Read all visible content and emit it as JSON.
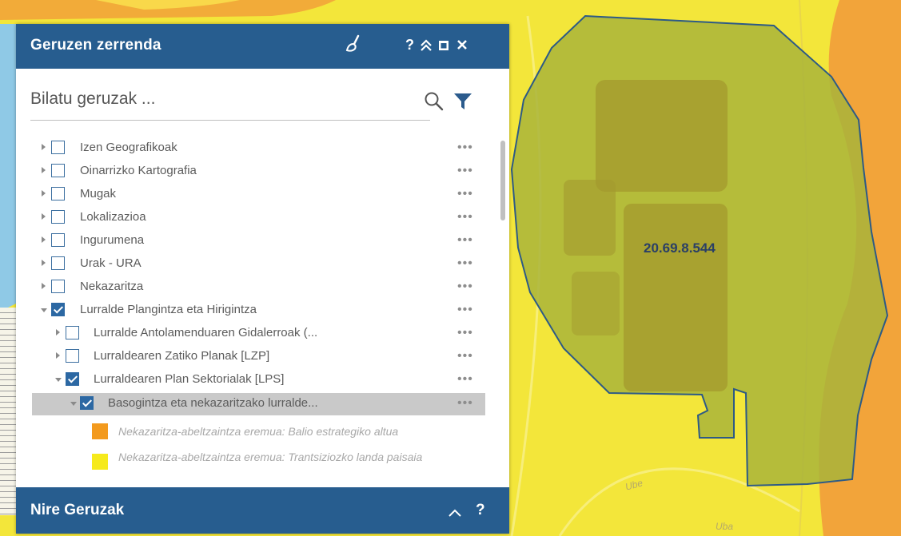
{
  "panel": {
    "title": "Geruzen zerrenda",
    "help": "?",
    "search_placeholder": "Bilatu geruzak ..."
  },
  "layers": [
    {
      "label": "Izen Geografikoak",
      "checked": false,
      "expanded": false,
      "level": 0
    },
    {
      "label": "Oinarrizko Kartografia",
      "checked": false,
      "expanded": false,
      "level": 0
    },
    {
      "label": "Mugak",
      "checked": false,
      "expanded": false,
      "level": 0
    },
    {
      "label": "Lokalizazioa",
      "checked": false,
      "expanded": false,
      "level": 0
    },
    {
      "label": "Ingurumena",
      "checked": false,
      "expanded": false,
      "level": 0
    },
    {
      "label": "Urak - URA",
      "checked": false,
      "expanded": false,
      "level": 0
    },
    {
      "label": "Nekazaritza",
      "checked": false,
      "expanded": false,
      "level": 0
    },
    {
      "label": "Lurralde Plangintza eta Hirigintza",
      "checked": true,
      "expanded": true,
      "level": 0
    },
    {
      "label": "Lurralde Antolamenduaren Gidalerroak (...",
      "checked": false,
      "expanded": false,
      "level": 1
    },
    {
      "label": "Lurraldearen Zatiko Planak [LZP]",
      "checked": false,
      "expanded": false,
      "level": 1
    },
    {
      "label": "Lurraldearen Plan Sektorialak [LPS]",
      "checked": true,
      "expanded": true,
      "level": 1
    },
    {
      "label": "Basogintza eta nekazaritzako lurralde...",
      "checked": true,
      "expanded": true,
      "level": 2,
      "selected": true
    }
  ],
  "more_icon": "•••",
  "legend": [
    {
      "label": "Nekazaritza-abeltzaintza eremua: Balio estrategiko altua",
      "color": "#f39a1e"
    },
    {
      "label": "Nekazaritza-abeltzaintza eremua: Trantsiziozko landa paisaia",
      "color": "#f6ea1c"
    }
  ],
  "footer": {
    "title": "Nire Geruzak",
    "chevron": "^",
    "help": "?"
  },
  "map": {
    "parcel_label": "20.69.8.544",
    "road_labels": [
      "Ube",
      "Uba"
    ]
  },
  "colors": {
    "header": "#275d8f",
    "checkbox": "#2c68a3",
    "map_yellow": "#f3e63a",
    "map_orange": "#f2a43a",
    "parcel_fill": "#a9b43b",
    "parcel_outline": "#2d5a86"
  },
  "icons": [
    "brush-icon",
    "help-icon",
    "collapse-icon",
    "maximize-icon",
    "close-icon",
    "search-icon",
    "filter-icon",
    "chevron-up-icon"
  ]
}
